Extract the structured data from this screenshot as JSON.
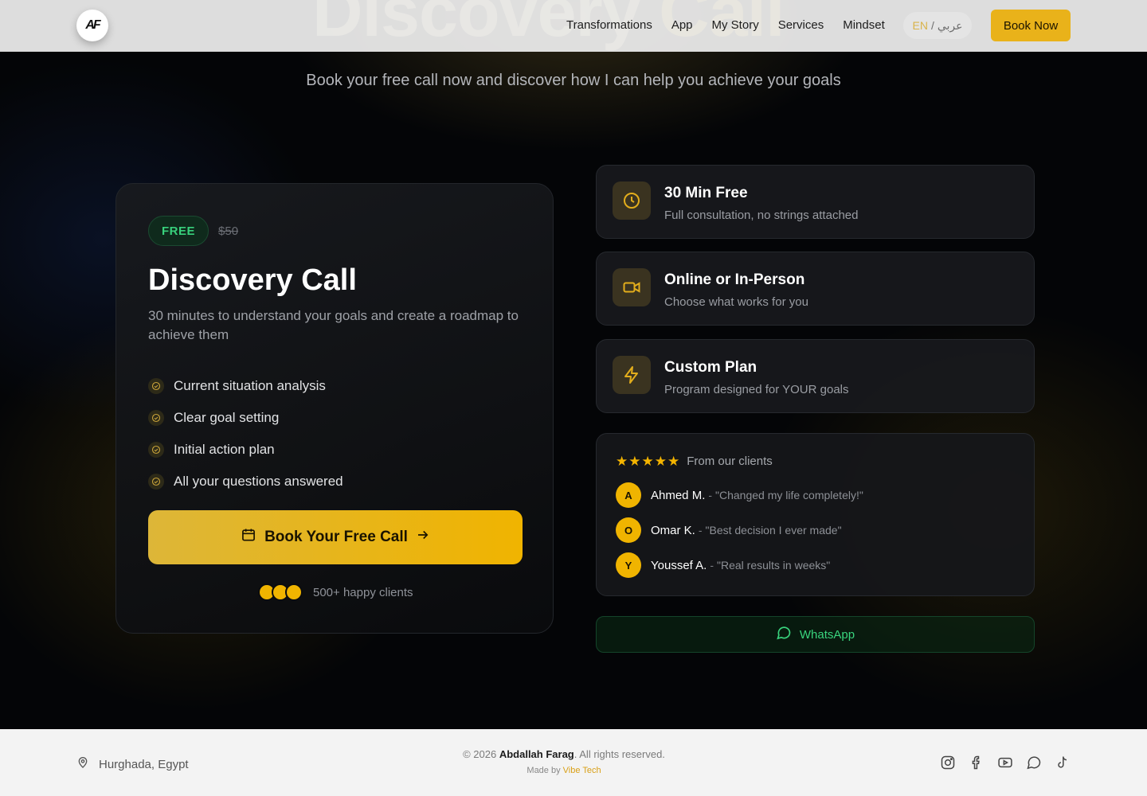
{
  "nav": {
    "logo_text": "AF",
    "links": [
      "Transformations",
      "App",
      "My Story",
      "Services",
      "Mindset"
    ],
    "lang_en": "EN",
    "lang_sep": "/",
    "lang_ar": "عربي",
    "book_label": "Book Now"
  },
  "hero": {
    "subtitle": "Book your free call now and discover how I can help you achieve your goals"
  },
  "offer": {
    "badge": "FREE",
    "old_price": "$50",
    "title": "Discovery Call",
    "description": "30 minutes to understand your goals and create a roadmap to achieve them",
    "features": [
      "Current situation analysis",
      "Clear goal setting",
      "Initial action plan",
      "All your questions answered"
    ],
    "cta_label": "Book Your Free Call",
    "happy_label": "500+ happy clients"
  },
  "highlights": [
    {
      "icon": "clock-icon",
      "title": "30 Min Free",
      "subtitle": "Full consultation, no strings attached"
    },
    {
      "icon": "video-camera-icon",
      "title": "Online or In-Person",
      "subtitle": "Choose what works for you"
    },
    {
      "icon": "lightning-icon",
      "title": "Custom Plan",
      "subtitle": "Program designed for YOUR goals"
    }
  ],
  "testimonials": {
    "rating": 5,
    "label": "From our clients",
    "items": [
      {
        "initial": "A",
        "name": "Ahmed M.",
        "quote": "\"Changed my life completely!\""
      },
      {
        "initial": "O",
        "name": "Omar K.",
        "quote": "\"Best decision I ever made\""
      },
      {
        "initial": "Y",
        "name": "Youssef A.",
        "quote": "\"Real results in weeks\""
      }
    ]
  },
  "whatsapp_label": "WhatsApp",
  "footer": {
    "location": "Hurghada, Egypt",
    "copyright_prefix": "© 2026",
    "owner": "Abdallah Farag",
    "rights": ". All rights reserved.",
    "made_by": "Made by",
    "made_by_brand": "Vibe Tech",
    "socials": [
      "instagram-icon",
      "facebook-icon",
      "youtube-icon",
      "whatsapp-icon",
      "tiktok-icon"
    ]
  },
  "colors": {
    "accent": "#f0b400",
    "success": "#38d17c",
    "background": "#050608"
  }
}
